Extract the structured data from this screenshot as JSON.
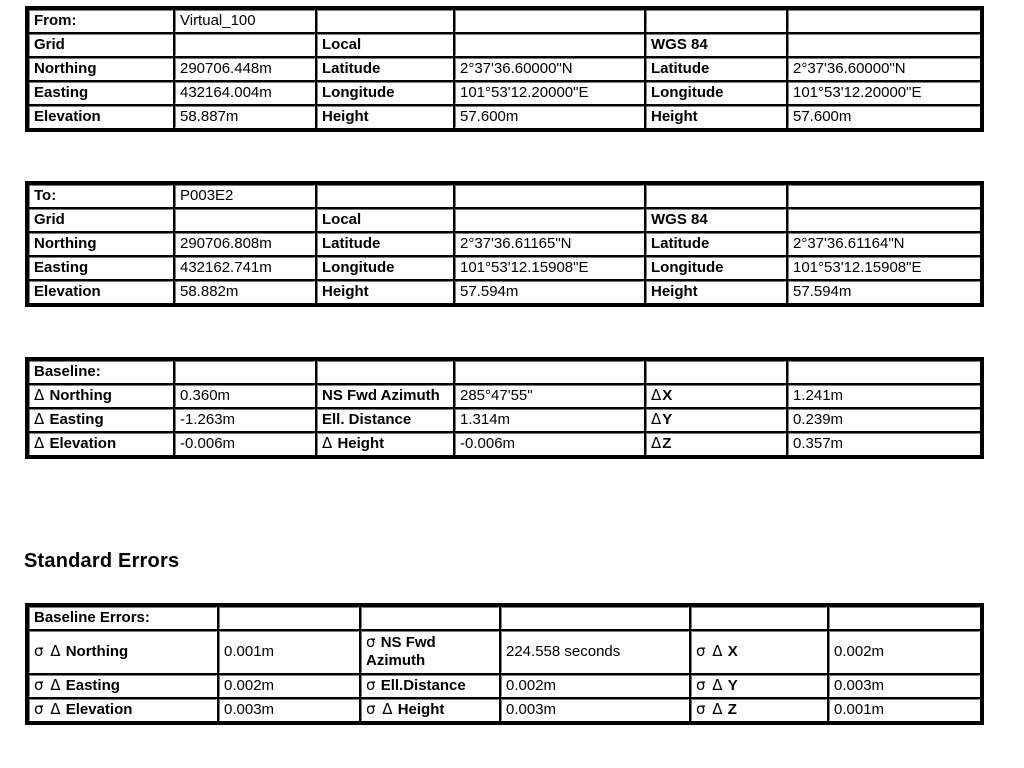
{
  "report": {
    "section_title": "Standard Errors"
  },
  "from_table": {
    "title_label": "From:",
    "title_value": "Virtual_100",
    "system_left_label": "Grid",
    "system_mid_label": "Local",
    "system_right_label": "WGS 84",
    "rows": [
      {
        "grid_label": "Northing",
        "grid_value": "290706.448m",
        "local_label": "Latitude",
        "local_value": "2°37'36.60000\"N",
        "wgs_label": "Latitude",
        "wgs_value": "2°37'36.60000\"N"
      },
      {
        "grid_label": "Easting",
        "grid_value": "432164.004m",
        "local_label": "Longitude",
        "local_value": "101°53'12.20000\"E",
        "wgs_label": "Longitude",
        "wgs_value": "101°53'12.20000\"E"
      },
      {
        "grid_label": "Elevation",
        "grid_value": "58.887m",
        "local_label": "Height",
        "local_value": "57.600m",
        "wgs_label": "Height",
        "wgs_value": "57.600m"
      }
    ]
  },
  "to_table": {
    "title_label": "To:",
    "title_value": "P003E2",
    "system_left_label": "Grid",
    "system_mid_label": "Local",
    "system_right_label": "WGS 84",
    "rows": [
      {
        "grid_label": "Northing",
        "grid_value": "290706.808m",
        "local_label": "Latitude",
        "local_value": "2°37'36.61165\"N",
        "wgs_label": "Latitude",
        "wgs_value": "2°37'36.61164\"N"
      },
      {
        "grid_label": "Easting",
        "grid_value": "432162.741m",
        "local_label": "Longitude",
        "local_value": "101°53'12.15908\"E",
        "wgs_label": "Longitude",
        "wgs_value": "101°53'12.15908\"E"
      },
      {
        "grid_label": "Elevation",
        "grid_value": "58.882m",
        "local_label": "Height",
        "local_value": "57.594m",
        "wgs_label": "Height",
        "wgs_value": "57.594m"
      }
    ]
  },
  "baseline_table": {
    "title_label": "Baseline:",
    "rows": [
      {
        "sym1": "Δ",
        "label1": "Northing",
        "value1": "0.360m",
        "sym2": "",
        "label2": "NS Fwd Azimuth",
        "value2": "285°47'55\"",
        "sym3": "Δ",
        "label3": "X",
        "value3": "1.241m"
      },
      {
        "sym1": "Δ",
        "label1": "Easting",
        "value1": "-1.263m",
        "sym2": "",
        "label2": "Ell. Distance",
        "value2": "1.314m",
        "sym3": "Δ",
        "label3": "Y",
        "value3": "0.239m"
      },
      {
        "sym1": "Δ",
        "label1": "Elevation",
        "value1": "-0.006m",
        "sym2": "Δ",
        "label2": "Height",
        "value2": "-0.006m",
        "sym3": "Δ",
        "label3": "Z",
        "value3": "0.357m"
      }
    ]
  },
  "errors_table": {
    "title_label": "Baseline Errors:",
    "rows": [
      {
        "sym1": "σ Δ",
        "label1": "Northing",
        "value1": "0.001m",
        "sym2": "σ",
        "label2": "NS Fwd Azimuth",
        "value2": "224.558 seconds",
        "sym3": "σ Δ",
        "label3": "X",
        "value3": "0.002m"
      },
      {
        "sym1": "σ Δ",
        "label1": "Easting",
        "value1": "0.002m",
        "sym2": "σ",
        "label2": "Ell.Distance",
        "value2": "0.002m",
        "sym3": "σ Δ",
        "label3": "Y",
        "value3": "0.003m"
      },
      {
        "sym1": "σ Δ",
        "label1": "Elevation",
        "value1": "0.003m",
        "sym2": "σ Δ",
        "label2": "Height",
        "value2": "0.003m",
        "sym3": "σ Δ",
        "label3": "Z",
        "value3": "0.001m"
      }
    ]
  }
}
